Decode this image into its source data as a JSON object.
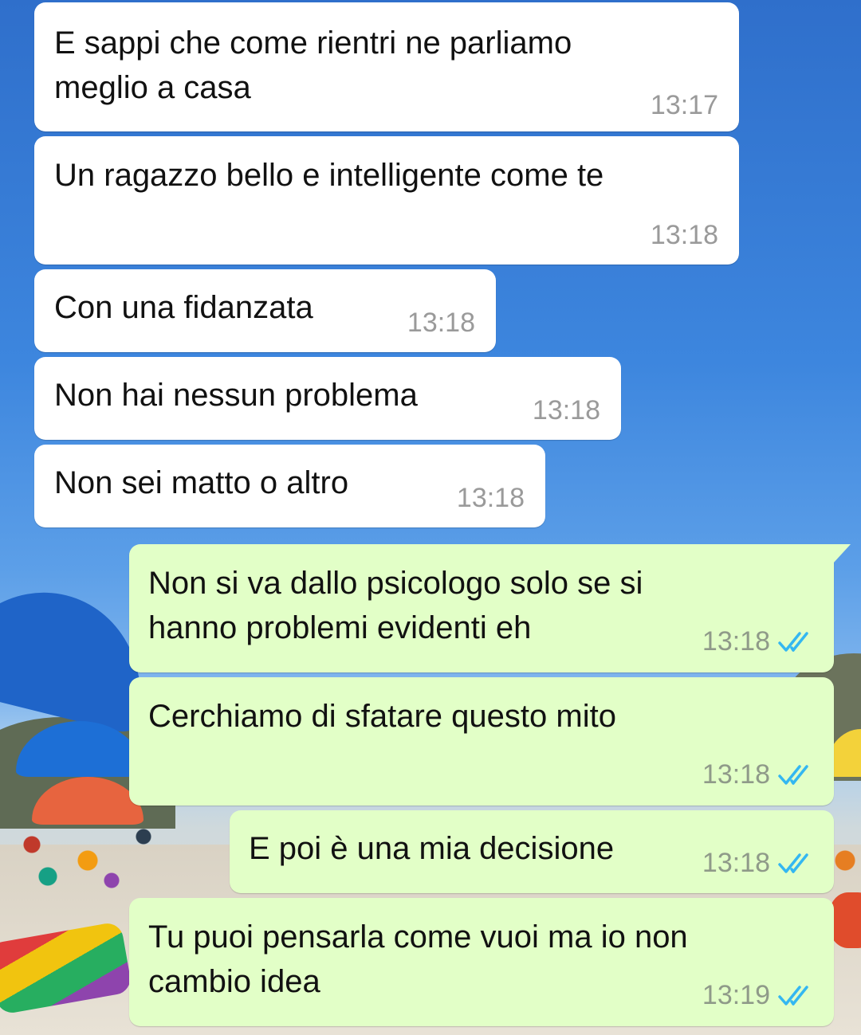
{
  "messages": [
    {
      "direction": "incoming",
      "text": "E sappi che come rientri ne parliamo meglio a casa",
      "lines": [
        "E sappi che come rientri ne parliamo",
        "meglio a casa"
      ],
      "time": "13:17"
    },
    {
      "direction": "incoming",
      "text": "Un ragazzo bello e intelligente come te",
      "lines": [
        "Un ragazzo bello e intelligente come te"
      ],
      "time": "13:18"
    },
    {
      "direction": "incoming",
      "text": "Con una fidanzata",
      "lines": [
        "Con una fidanzata"
      ],
      "time": "13:18"
    },
    {
      "direction": "incoming",
      "text": "Non hai nessun problema",
      "lines": [
        "Non hai nessun problema"
      ],
      "time": "13:18"
    },
    {
      "direction": "incoming",
      "text": "Non sei matto o altro",
      "lines": [
        "Non sei matto o altro"
      ],
      "time": "13:18"
    },
    {
      "direction": "outgoing",
      "text": "Non si va dallo psicologo solo se si hanno problemi evidenti eh",
      "lines": [
        "Non si va dallo psicologo solo se si",
        "hanno problemi evidenti eh"
      ],
      "time": "13:18",
      "status_icon": "double-check-read-icon"
    },
    {
      "direction": "outgoing",
      "text": "Cerchiamo di sfatare questo mito",
      "lines": [
        "Cerchiamo di sfatare questo mito"
      ],
      "time": "13:18",
      "status_icon": "double-check-read-icon"
    },
    {
      "direction": "outgoing",
      "text": "E poi è una mia decisione",
      "lines": [
        "E poi è una mia decisione"
      ],
      "time": "13:18",
      "status_icon": "double-check-read-icon"
    },
    {
      "direction": "outgoing",
      "text": "Tu puoi pensarla come vuoi ma io non cambio idea",
      "lines": [
        "Tu puoi pensarla come vuoi ma io non",
        "cambio idea"
      ],
      "time": "13:19",
      "status_icon": "double-check-read-icon"
    }
  ],
  "colors": {
    "incoming_bubble": "#ffffff",
    "outgoing_bubble": "#e2ffc7",
    "read_ticks": "#34b7f1",
    "timestamp": "#9a9a9a"
  }
}
